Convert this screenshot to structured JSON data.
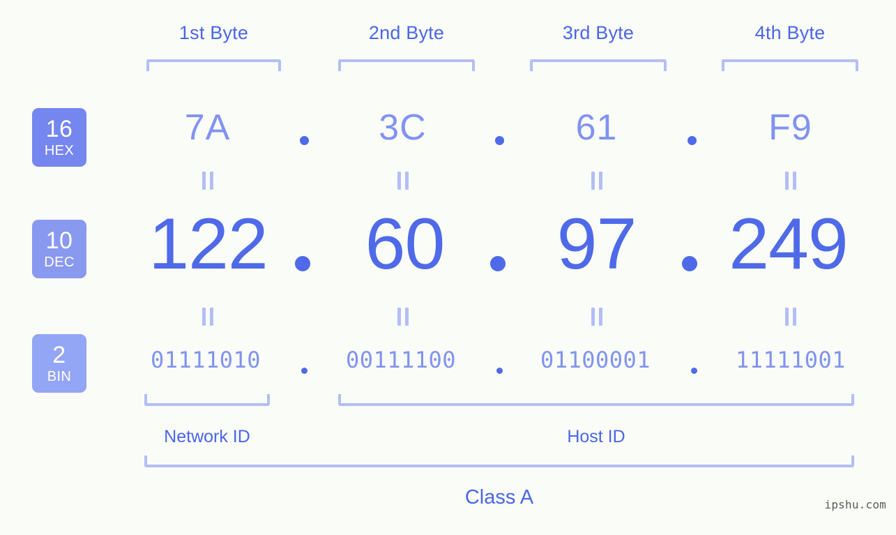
{
  "background_color": "#fafcf8",
  "colors": {
    "header_blue": "#4a66e8",
    "value_blue": "#8193f0",
    "decimal_blue": "#4f6ae8",
    "bracket_blue": "#b3bef7",
    "badge_hex": "#7586ee",
    "badge_dec": "#8a99f0",
    "badge_bin": "#93a5f5"
  },
  "byte_headers": [
    {
      "label": "1st Byte"
    },
    {
      "label": "2nd Byte"
    },
    {
      "label": "3rd Byte"
    },
    {
      "label": "4th Byte"
    }
  ],
  "bases": [
    {
      "num": "16",
      "abbr": "HEX"
    },
    {
      "num": "10",
      "abbr": "DEC"
    },
    {
      "num": "2",
      "abbr": "BIN"
    }
  ],
  "rows": {
    "hex": {
      "values": [
        "7A",
        "3C",
        "61",
        "F9"
      ]
    },
    "dec": {
      "values": [
        "122",
        "60",
        "97",
        "249"
      ]
    },
    "bin": {
      "values": [
        "01111010",
        "00111100",
        "01100001",
        "11111001"
      ]
    }
  },
  "separator": ".",
  "equality_symbol": "=",
  "regions": [
    {
      "label": "Network ID"
    },
    {
      "label": "Host ID"
    }
  ],
  "class": {
    "label": "Class A"
  },
  "watermark": {
    "text": "ipshu.com"
  }
}
